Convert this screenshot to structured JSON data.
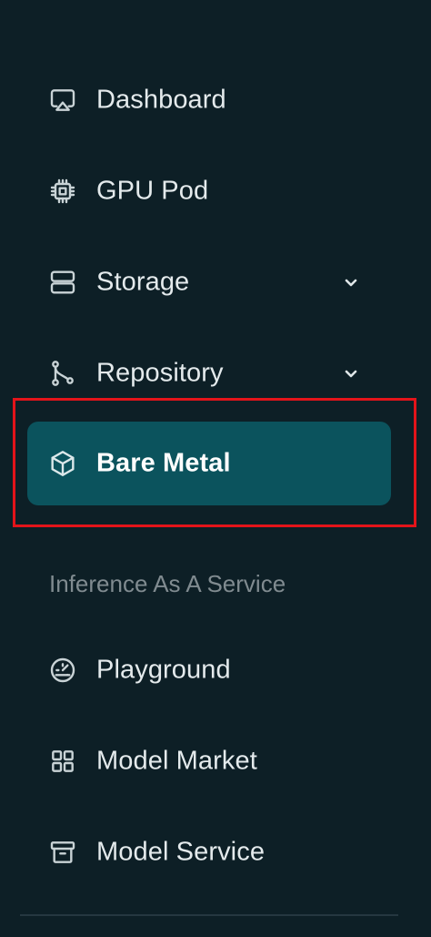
{
  "sidebar": {
    "items": [
      {
        "label": "Dashboard",
        "icon": "monitor-icon",
        "has_submenu": false,
        "active": false
      },
      {
        "label": "GPU Pod",
        "icon": "chip-icon",
        "has_submenu": false,
        "active": false
      },
      {
        "label": "Storage",
        "icon": "server-icon",
        "has_submenu": true,
        "active": false
      },
      {
        "label": "Repository",
        "icon": "git-branch-icon",
        "has_submenu": true,
        "active": false
      },
      {
        "label": "Bare Metal",
        "icon": "cube-icon",
        "has_submenu": false,
        "active": true
      }
    ],
    "section_title": "Inference As A Service",
    "section_items": [
      {
        "label": "Playground",
        "icon": "gauge-icon",
        "active": false
      },
      {
        "label": "Model Market",
        "icon": "grid-icon",
        "active": false
      },
      {
        "label": "Model Service",
        "icon": "archive-icon",
        "active": false
      }
    ]
  },
  "colors": {
    "background": "#0d1f26",
    "active_item": "#0b535d",
    "highlight_border": "#e3141a",
    "text": "#e4eaec",
    "section_title": "#808b90"
  }
}
